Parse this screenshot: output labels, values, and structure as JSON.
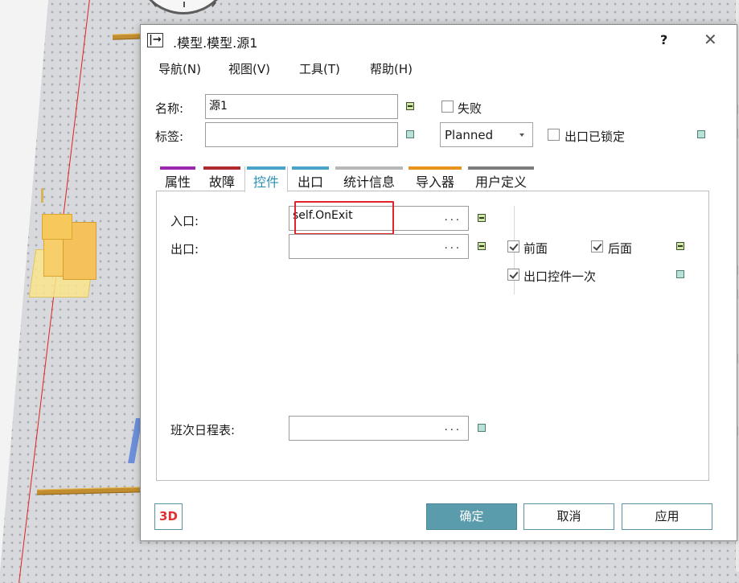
{
  "dialog": {
    "title": ".模型.模型.源1",
    "title_icon": "|→",
    "help_label": "?",
    "close_label": "✕"
  },
  "menu": [
    "导航(N)",
    "视图(V)",
    "工具(T)",
    "帮助(H)"
  ],
  "header": {
    "name_label": "名称:",
    "name_value": "源1",
    "tag_label": "标签:",
    "tag_value": "",
    "fail_label": "失败",
    "fail_checked": false,
    "mode_value": "Planned",
    "exit_locked_label": "出口已锁定",
    "exit_locked_checked": false
  },
  "tabs": [
    {
      "label": "属性",
      "color": "#9b27b0"
    },
    {
      "label": "故障",
      "color": "#b0282a"
    },
    {
      "label": "控件",
      "color": "#4aa3c8",
      "active": true
    },
    {
      "label": "出口",
      "color": "#4aa3c8"
    },
    {
      "label": "统计信息",
      "color": "#b8b8b8"
    },
    {
      "label": "导入器",
      "color": "#e8941a"
    },
    {
      "label": "用户定义",
      "color": "#7d7d7d"
    }
  ],
  "controls": {
    "entry_label": "入口:",
    "entry_value": "self.OnExit",
    "exit_label": "出口:",
    "exit_value": "",
    "front_label": "前面",
    "front_checked": true,
    "rear_label": "后面",
    "rear_checked": true,
    "exit_once_label": "出口控件一次",
    "exit_once_checked": true,
    "shift_label": "班次日程表:",
    "shift_value": "",
    "ellipsis": "..."
  },
  "footer": {
    "btn_3d": "3D",
    "ok": "确定",
    "cancel": "取消",
    "apply": "应用"
  }
}
